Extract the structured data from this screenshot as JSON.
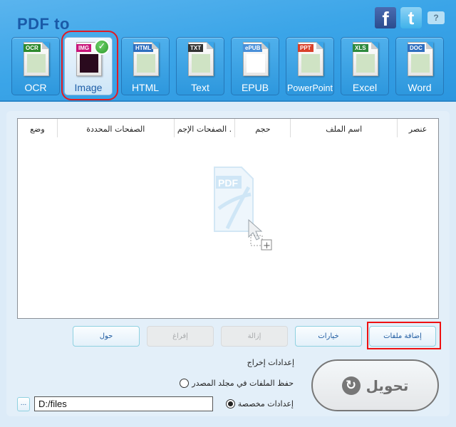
{
  "header": {
    "title": "PDF to",
    "social": {
      "facebook": "f",
      "twitter": "t",
      "help": "?"
    }
  },
  "formats": [
    {
      "label": "OCR",
      "tag": "OCR",
      "tag_color": "#2e8a2e",
      "selected": false
    },
    {
      "label": "Image",
      "tag": "IMG",
      "tag_color": "#c8157a",
      "selected": true
    },
    {
      "label": "HTML",
      "tag": "HTML",
      "tag_color": "#2f6fbf",
      "selected": false
    },
    {
      "label": "Text",
      "tag": "TXT",
      "tag_color": "#333333",
      "selected": false
    },
    {
      "label": "EPUB",
      "tag": "ePUB",
      "tag_color": "#4a90d9",
      "selected": false
    },
    {
      "label": "PowerPoint",
      "tag": "PPT",
      "tag_color": "#d9412a",
      "selected": false
    },
    {
      "label": "Excel",
      "tag": "XLS",
      "tag_color": "#2e8a3e",
      "selected": false
    },
    {
      "label": "Word",
      "tag": "DOC",
      "tag_color": "#2f6fbf",
      "selected": false
    }
  ],
  "table": {
    "columns": [
      "عنصر",
      "اسم الملف",
      "حجم",
      ". الصفحات الإجم",
      "الصفحات المحددة",
      "وضع"
    ],
    "rows": []
  },
  "drop_hint": {
    "doc_label": "PDF",
    "plus": "+"
  },
  "actions": {
    "add_files": "إضافة ملفات",
    "options": "خيارات",
    "remove": "إزالة",
    "clear": "إفراغ",
    "about": "حول"
  },
  "output": {
    "title": "إعدادات إخراج",
    "option_source": "حفظ الملفات في مجلد المصدر",
    "option_custom": "إعدادات مخصصة",
    "selected": "custom",
    "path": "D:/files",
    "browse": "..."
  },
  "convert": {
    "label": "تحويل",
    "icon": "↻"
  }
}
